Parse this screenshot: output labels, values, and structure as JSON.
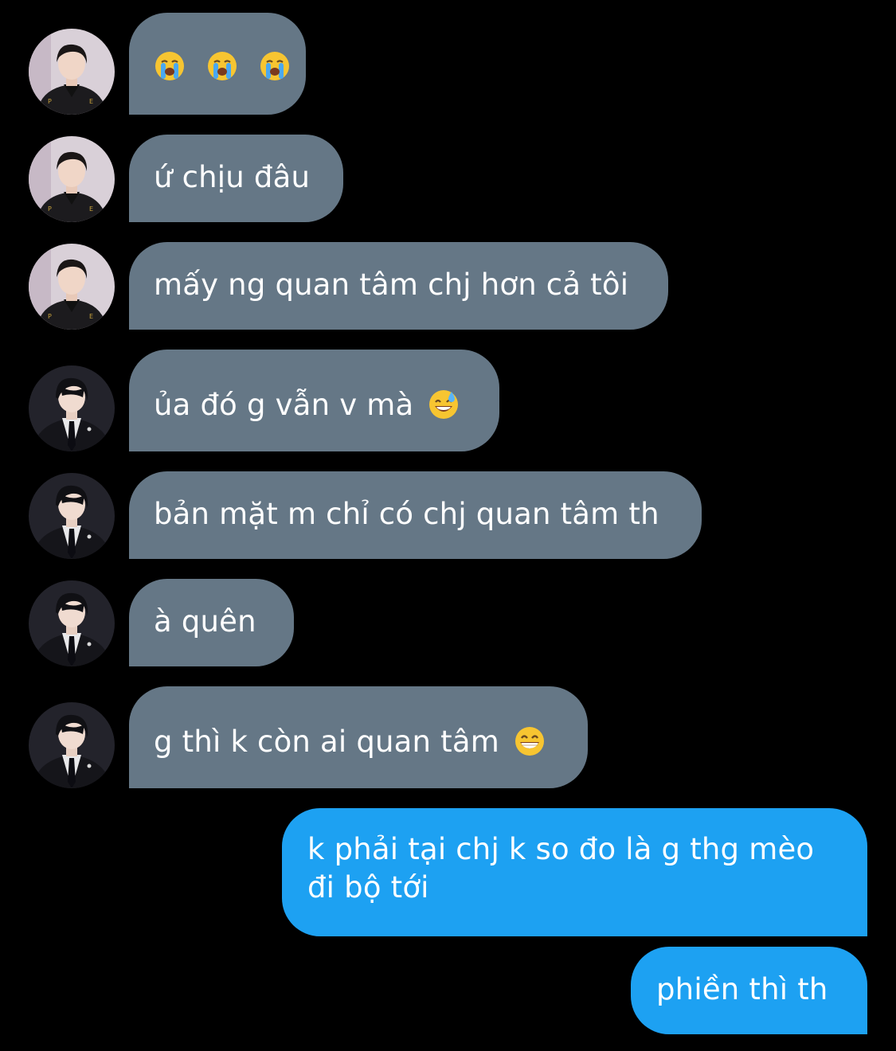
{
  "colors": {
    "background": "#000000",
    "incoming_bubble": "#657786",
    "outgoing_bubble": "#1da1f2",
    "text": "#ffffff"
  },
  "messages": [
    {
      "direction": "incoming",
      "avatar": "avatar-boy-tracksuit",
      "text": "",
      "emojis": [
        "loudly-crying-face-icon",
        "loudly-crying-face-icon",
        "loudly-crying-face-icon"
      ]
    },
    {
      "direction": "incoming",
      "avatar": "avatar-boy-tracksuit",
      "text": "ứ chịu đâu",
      "emojis": []
    },
    {
      "direction": "incoming",
      "avatar": "avatar-boy-tracksuit",
      "text": "mấy ng quan tâm chj hơn cả tôi",
      "emojis": []
    },
    {
      "direction": "incoming",
      "avatar": "avatar-boy-suit",
      "text": "ủa đó g vẫn v mà",
      "emojis": [
        "grinning-sweat-face-icon"
      ]
    },
    {
      "direction": "incoming",
      "avatar": "avatar-boy-suit",
      "text": "bản mặt m chỉ có chj quan tâm th",
      "emojis": []
    },
    {
      "direction": "incoming",
      "avatar": "avatar-boy-suit",
      "text": "à quên",
      "emojis": []
    },
    {
      "direction": "incoming",
      "avatar": "avatar-boy-suit",
      "text": "g thì k còn ai quan tâm",
      "emojis": [
        "beaming-grin-face-icon"
      ]
    },
    {
      "direction": "outgoing",
      "avatar": "",
      "text": "k phải tại chj k so đo là g thg mèo đi bộ tới",
      "emojis": []
    },
    {
      "direction": "outgoing",
      "avatar": "",
      "text": "phiền thì th",
      "emojis": []
    }
  ]
}
